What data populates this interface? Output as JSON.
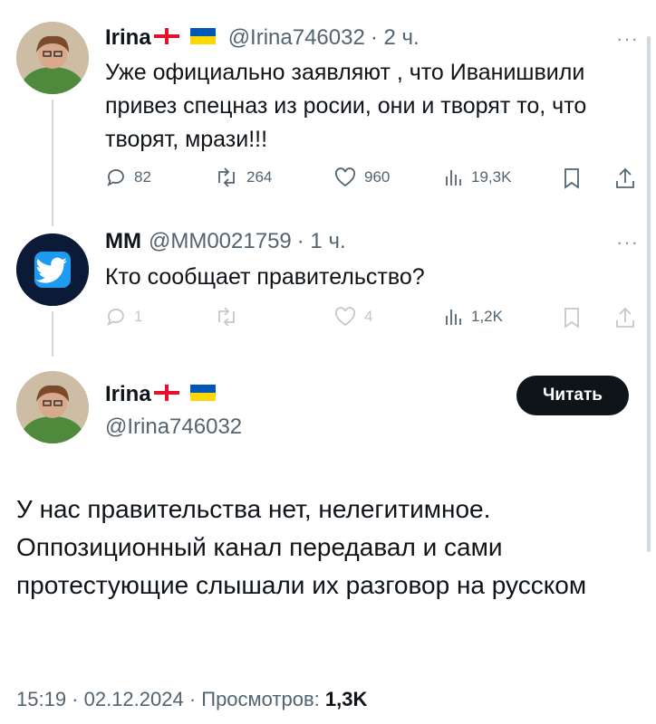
{
  "tweets": [
    {
      "name": "Irina",
      "handle": "@Irina746032",
      "time": "· 2 ч.",
      "text": "Уже официально заявляют , что Иванишвили привез спецназ из росии, они и творят то, что творят, мрази!!!",
      "stats": {
        "replies": "82",
        "retweets": "264",
        "likes": "960",
        "views": "19,3K"
      }
    },
    {
      "name": "MM",
      "handle": "@MM0021759",
      "time": "· 1 ч.",
      "text": "Кто сообщает правительство?",
      "stats": {
        "replies": "1",
        "retweets": "",
        "likes": "4",
        "views": "1,2K"
      }
    }
  ],
  "main": {
    "name": "Irina",
    "handle": "@Irina746032",
    "follow_label": "Читать",
    "text": "У нас правительства нет, нелегитимное. Оппозиционный канал передавал и сами протестующие слышали их разговор на русском",
    "timestamp": "15:19 · 02.12.2024 · Просмотров: ",
    "views": "1,3K"
  },
  "icons": [
    "reply-icon",
    "retweet-icon",
    "like-icon",
    "views-icon",
    "bookmark-icon",
    "share-icon",
    "more-icon",
    "georgia-flag-icon",
    "ukraine-flag-icon",
    "twitter-bird-icon"
  ]
}
